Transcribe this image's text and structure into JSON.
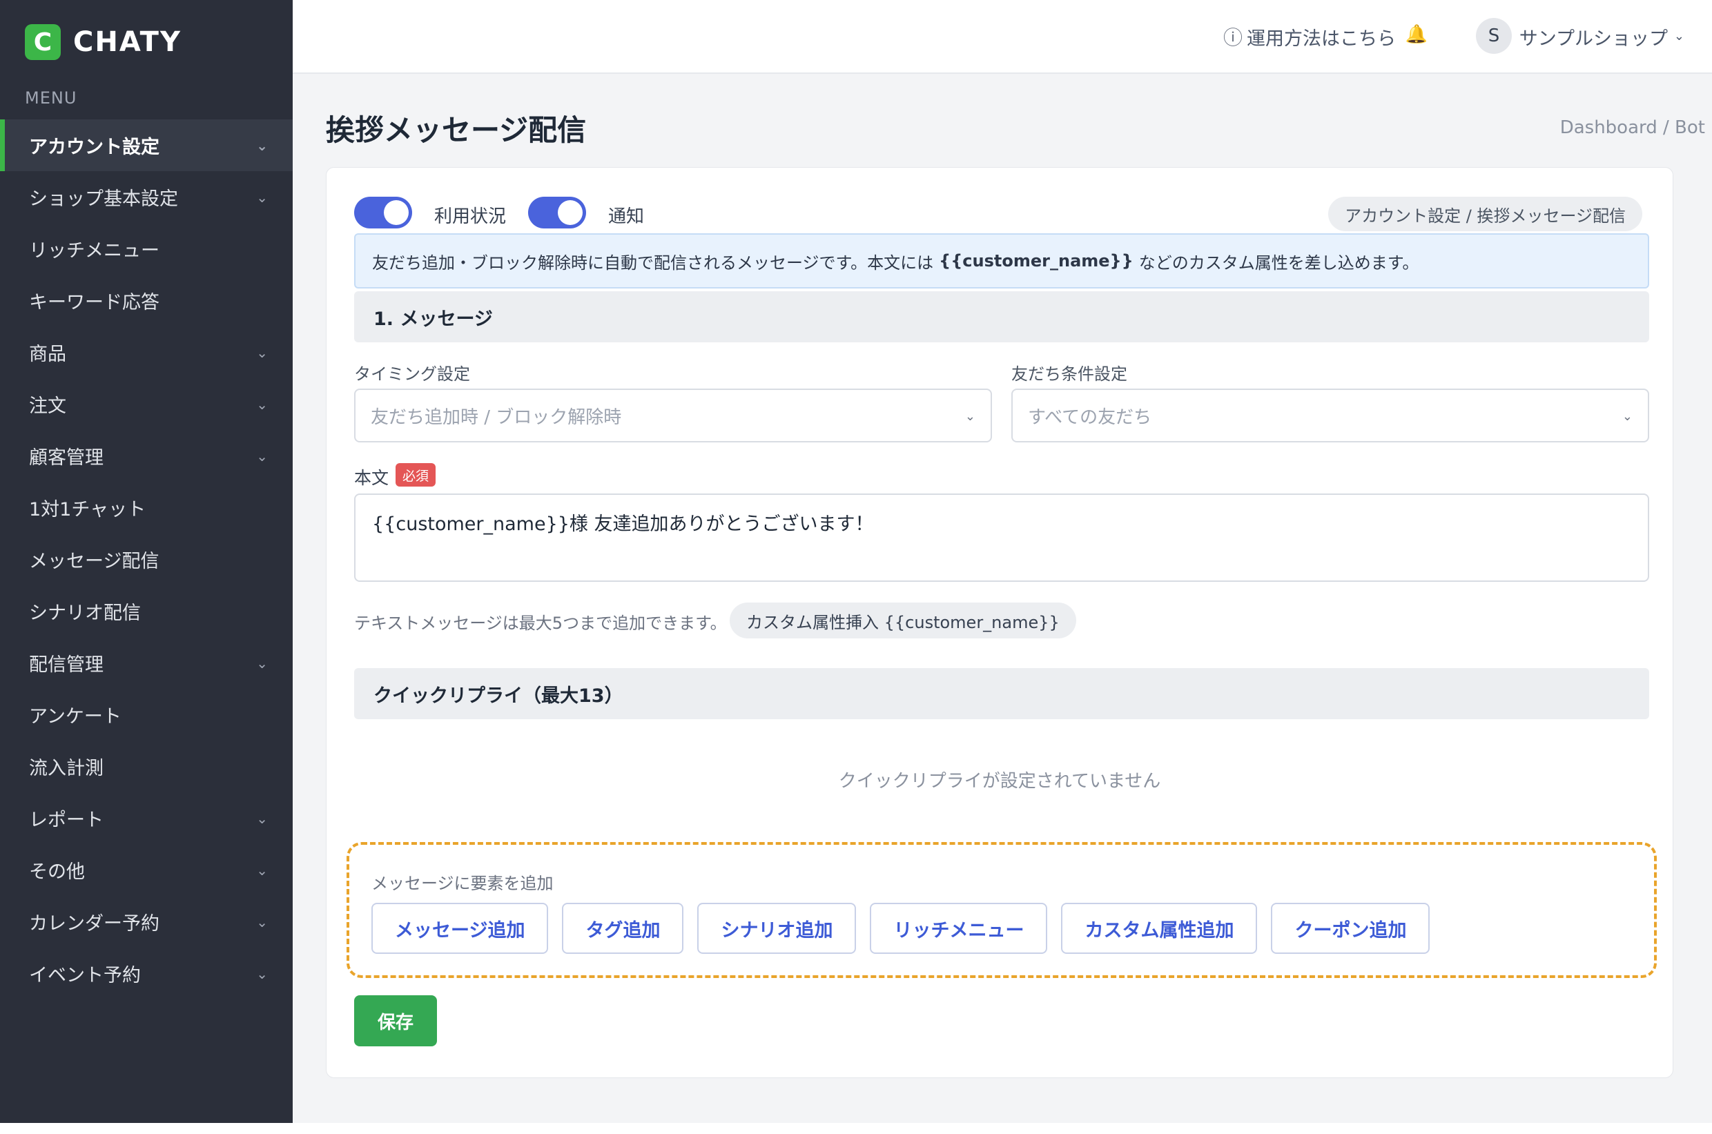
{
  "sidebar": {
    "brand_initial": "C",
    "brand_name": "CHATY",
    "menu_label": "MENU",
    "items": [
      {
        "label": "アカウント設定",
        "chevron": "⌄"
      },
      {
        "label": "ショップ基本設定",
        "chevron": "⌄"
      },
      {
        "label": "リッチメニュー",
        "chevron": ""
      },
      {
        "label": "キーワード応答",
        "chevron": ""
      },
      {
        "label": "商品",
        "chevron": "⌄"
      },
      {
        "label": "注文",
        "chevron": "⌄"
      },
      {
        "label": "顧客管理",
        "chevron": "⌄"
      },
      {
        "label": "1対1チャット",
        "chevron": ""
      },
      {
        "label": "メッセージ配信",
        "chevron": ""
      },
      {
        "label": "シナリオ配信",
        "chevron": ""
      },
      {
        "label": "配信管理",
        "chevron": "⌄"
      },
      {
        "label": "アンケート",
        "chevron": ""
      },
      {
        "label": "流入計測",
        "chevron": ""
      },
      {
        "label": "レポート",
        "chevron": "⌄"
      },
      {
        "label": "その他",
        "chevron": "⌄"
      },
      {
        "label": "カレンダー予約",
        "chevron": "⌄"
      },
      {
        "label": "イベント予約",
        "chevron": "⌄"
      }
    ]
  },
  "header": {
    "help_icon": "ⓘ",
    "help_text": "運用方法はこちら",
    "bell_icon": "🔔",
    "avatar_initial": "S",
    "shop_name": "サンプルショップ",
    "shop_chevron": "⌄"
  },
  "page": {
    "title": "挨拶メッセージ配信",
    "breadcrumb": "Dashboard / Bot"
  },
  "card": {
    "toggle_usage_label": "利用状況",
    "toggle_notify_label": "通知",
    "path_pill": "アカウント設定 / 挨拶メッセージ配信",
    "info_before": "友だち追加・ブロック解除時に自動で配信されるメッセージです。本文には",
    "info_bold": "{{customer_name}}",
    "info_after": "などのカスタム属性を差し込めます。",
    "section_message": "1. メッセージ",
    "timing_label": "タイミング設定",
    "timing_placeholder": "友だち追加時 / ブロック解除時",
    "friend_label": "友だち条件設定",
    "friend_placeholder": "すべての友だち",
    "body_label": "本文",
    "required_badge": "必須",
    "body_text": "{{customer_name}}様 友達追加ありがとうございます！",
    "hint": "テキストメッセージは最大5つまで追加できます。",
    "attr_pill": "カスタム属性挿入 {{customer_name}}",
    "section_quick": "クイックリプライ（最大13）",
    "quick_empty": "クイックリプライが設定されていません",
    "add_title": "メッセージに要素を追加",
    "add_buttons": [
      "メッセージ追加",
      "タグ追加",
      "シナリオ追加",
      "リッチメニュー",
      "カスタム属性追加",
      "クーポン追加"
    ],
    "save_label": "保存"
  },
  "colors": {
    "sidebar_bg": "#2b2f3a",
    "brand_green": "#3cb648",
    "toggle_on": "#4a63dc",
    "add_button_text": "#3d5bd6",
    "dashed_border": "#e9a42b",
    "save_bg": "#34a853",
    "required_bg": "#e45656"
  }
}
